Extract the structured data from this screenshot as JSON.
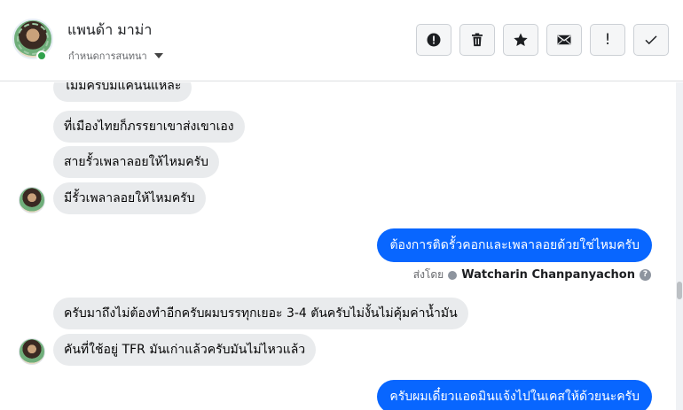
{
  "header": {
    "contact_name": "แพนด้า มาม่า",
    "assign_label": "กำหนดการสนทนา",
    "actions": {
      "spam": "spam-alert-icon",
      "delete": "trash-icon",
      "star": "star-icon",
      "unread": "envelope-icon",
      "follow_up": "!",
      "done": "checkmark-icon"
    }
  },
  "thread": {
    "messages": [
      {
        "side": "in",
        "text": "ไม่มีครับมีแค่นั้นแหละ"
      },
      {
        "side": "in",
        "text": "ที่เมืองไทยก็ภรรยาเขาส่งเขาเอง"
      },
      {
        "side": "in",
        "text": "สายรั้วเพลาลอยให้ไหมครับ"
      },
      {
        "side": "in",
        "text": "มีรั้วเพลาลอยให้ไหมครับ"
      },
      {
        "side": "out",
        "text": "ต้องการติดรั้วคอกและเพลาลอยด้วยใช่ไหมครับ"
      },
      {
        "side": "in",
        "text": "ครับมาถึงไม่ต้องทำอีกครับผมบรรทุกเยอะ 3-4 ตันครับไม่งั้นไม่คุ้มค่าน้ำมัน"
      },
      {
        "side": "in",
        "text": "คันที่ใช้อยู่ TFR มันเก่าแล้วครับมันไม่ไหวแล้ว"
      },
      {
        "side": "out",
        "text": "ครับผมเดี๋ยวแอดมินแจ้งไปในเคสให้ด้วยนะครับ"
      }
    ],
    "sent_by_label": "ส่งโดย",
    "sent_by_name": "Watcharin Chanpanyachon",
    "help_mark": "?"
  }
}
